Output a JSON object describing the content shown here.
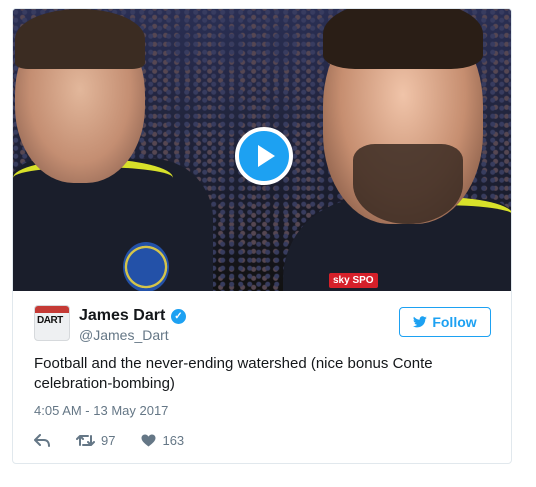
{
  "video": {
    "sky_logo": "sky SPO",
    "play_icon": "play-icon"
  },
  "tweet": {
    "avatar_text": "DART",
    "user_name": "James Dart",
    "handle": "@James_Dart",
    "verified_icon": "check-icon",
    "follow_label": "Follow",
    "follow_icon": "twitter-bird-icon",
    "text": "Football and the never-ending watershed (nice bonus Conte celebration-bombing)",
    "timestamp": "4:05 AM - 13 May 2017",
    "retweet_count": "97",
    "like_count": "163"
  },
  "colors": {
    "twitter_blue": "#1da1f2",
    "muted_text": "#657786",
    "border": "#e1e8ed"
  }
}
